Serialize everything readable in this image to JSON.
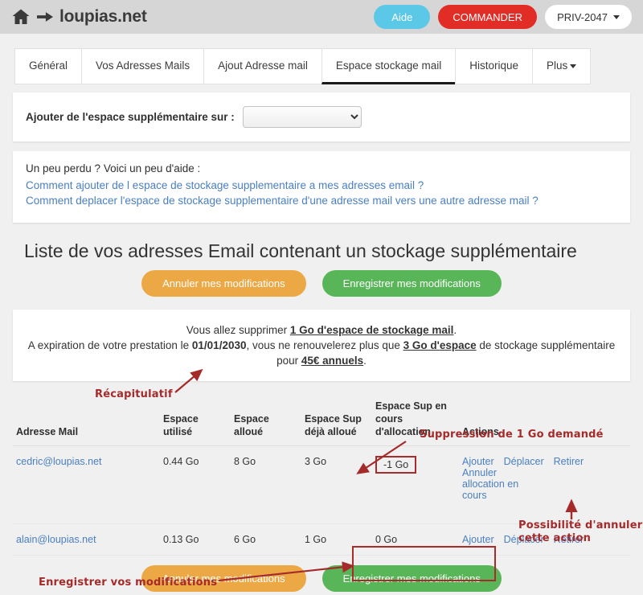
{
  "topbar": {
    "home_icon": "home-icon",
    "arrow_icon": "arrow-right-icon",
    "brand": "loupias.net",
    "help_button": "Aide",
    "order_button": "COMMANDER",
    "account_button": "PRIV-2047",
    "colors": {
      "help_bg": "#5bc8e8",
      "order_bg": "#e22d26",
      "account_bg": "#ffffff",
      "bar_bg": "#d6d6d6"
    }
  },
  "tabs": [
    {
      "label": "Général",
      "active": false
    },
    {
      "label": "Vos Adresses Mails",
      "active": false
    },
    {
      "label": "Ajout Adresse mail",
      "active": false
    },
    {
      "label": "Espace stockage mail",
      "active": true
    },
    {
      "label": "Historique",
      "active": false
    },
    {
      "label": "Plus",
      "active": false,
      "has_caret": true
    }
  ],
  "add_space": {
    "label": "Ajouter de l'espace supplémentaire sur :",
    "select_value": "",
    "select_placeholder": ""
  },
  "help": {
    "title": "Un peu perdu ? Voici un peu d'aide :",
    "links": [
      "Comment ajouter de l espace de stockage supplementaire a mes adresses email ?",
      "Comment deplacer l'espace de stockage supplementaire d'une adresse mail vers une autre adresse mail ?"
    ]
  },
  "section": {
    "title": "Liste de vos adresses Email contenant un stockage supplémentaire",
    "cancel_button": "Annuler mes modifications",
    "save_button": "Enregistrer mes modifications",
    "colors": {
      "cancel_bg": "#eda846",
      "save_bg": "#58b658"
    }
  },
  "summary": {
    "line1_prefix": "Vous allez supprimer ",
    "line1_strong": "1 Go d'espace de stockage mail",
    "line1_suffix": ".",
    "line2_prefix": "A expiration de votre prestation le ",
    "line2_date": "01/01/2030",
    "line2_mid": ", vous ne renouvelerez plus que ",
    "line2_amount": "3 Go d'espace",
    "line2_suffix": " de stockage supplémentaire pour ",
    "line2_price": "45€ annuels",
    "line2_end": "."
  },
  "table": {
    "headers": [
      "Adresse Mail",
      "Espace utilisé",
      "Espace alloué",
      "Espace Sup déjà alloué",
      "Espace Sup en cours d'allocation",
      "Actions"
    ],
    "rows": [
      {
        "email": "cedric@loupias.net",
        "used": "0.44 Go",
        "allocated": "8 Go",
        "extra_allocated": "3 Go",
        "pending": "-1 Go",
        "pending_highlighted": true,
        "actions": [
          "Ajouter",
          "Déplacer",
          "Retirer",
          "Annuler allocation en cours"
        ]
      },
      {
        "email": "alain@loupias.net",
        "used": "0.13 Go",
        "allocated": "6 Go",
        "extra_allocated": "1 Go",
        "pending": "0 Go",
        "pending_highlighted": false,
        "actions": [
          "Ajouter",
          "Déplacer",
          "Retirer"
        ]
      }
    ]
  },
  "annotations": {
    "color": "#a52a2a",
    "recap": "Récapitulatif",
    "deletion": "Suppression de 1 Go demandé",
    "cancel_possible_l1": "Possibilité d'annuler",
    "cancel_possible_l2": "cette action",
    "save_changes": "Enregistrer vos modifications"
  }
}
